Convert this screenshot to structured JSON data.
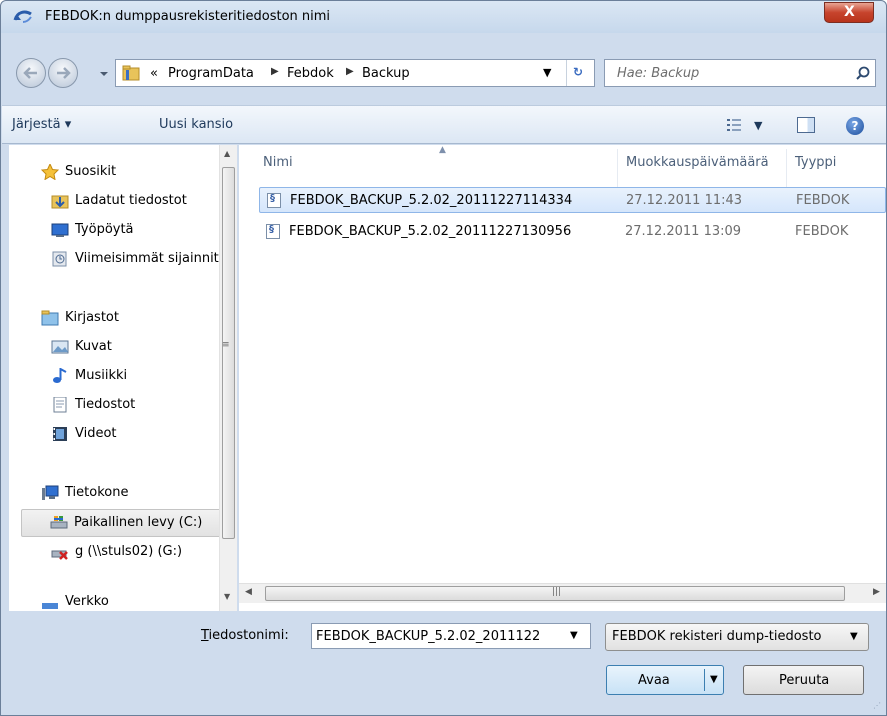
{
  "window": {
    "title": "FEBDOK:n dumppausrekisteritiedoston nimi",
    "close_label": "X"
  },
  "address": {
    "overflow": "«",
    "crumbs": [
      "ProgramData",
      "Febdok",
      "Backup"
    ],
    "search_placeholder": "Hae: Backup"
  },
  "toolbar": {
    "organize": "Järjestä ▾",
    "new_folder": "Uusi kansio"
  },
  "nav": {
    "favorites_header": "Suosikit",
    "favorites": [
      "Ladatut tiedostot",
      "Työpöytä",
      "Viimeisimmät sijainnit"
    ],
    "libraries_header": "Kirjastot",
    "libraries": [
      "Kuvat",
      "Musiikki",
      "Tiedostot",
      "Videot"
    ],
    "computer_header": "Tietokone",
    "computer": [
      "Paikallinen levy (C:)",
      "g (\\\\stuls02) (G:)"
    ],
    "network_header": "Verkko"
  },
  "columns": {
    "name": "Nimi",
    "modified": "Muokkauspäivämäärä",
    "type": "Tyyppi"
  },
  "files": [
    {
      "name": "FEBDOK_BACKUP_5.2.02_20111227114334",
      "modified": "27.12.2011 11:43",
      "type": "FEBDOK"
    },
    {
      "name": "FEBDOK_BACKUP_5.2.02_20111227130956",
      "modified": "27.12.2011 13:09",
      "type": "FEBDOK"
    }
  ],
  "bottom": {
    "filename_label_accel": "T",
    "filename_label_rest": "iedostonimi:",
    "filename_value": "FEBDOK_BACKUP_5.2.02_2011122",
    "filetype": "FEBDOK rekisteri dump-tiedosto",
    "open_label": "Avaa",
    "cancel_label": "Peruuta"
  },
  "colors": {
    "chrome": "#cfdced",
    "selection": "#d5e6fb",
    "toolbar_text": "#1e395b"
  }
}
